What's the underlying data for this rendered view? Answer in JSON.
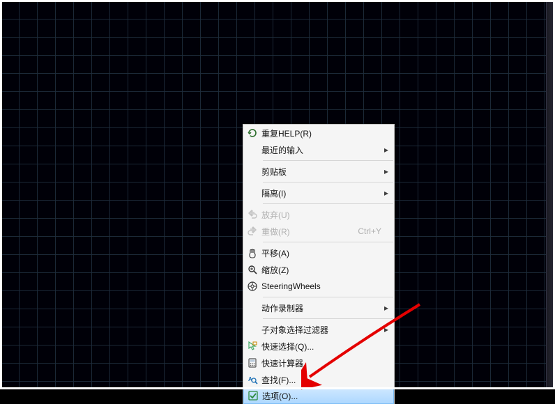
{
  "menu": {
    "items": [
      {
        "label": "重复HELP(R)"
      },
      {
        "label": "最近的输入"
      }
    ],
    "clipboard": {
      "label": "剪贴板"
    },
    "isolate": {
      "label": "隔离(I)"
    },
    "undo": {
      "label": "放弃(U)"
    },
    "redo": {
      "label": "重做(R)",
      "shortcut": "Ctrl+Y"
    },
    "pan": {
      "label": "平移(A)"
    },
    "zoom": {
      "label": "缩放(Z)"
    },
    "steering": {
      "label": "SteeringWheels"
    },
    "recorder": {
      "label": "动作录制器"
    },
    "subfilter": {
      "label": "子对象选择过滤器"
    },
    "qselect": {
      "label": "快速选择(Q)..."
    },
    "quickcalc": {
      "label": "快速计算器"
    },
    "find": {
      "label": "查找(F)..."
    },
    "options": {
      "label": "选项(O)..."
    }
  }
}
